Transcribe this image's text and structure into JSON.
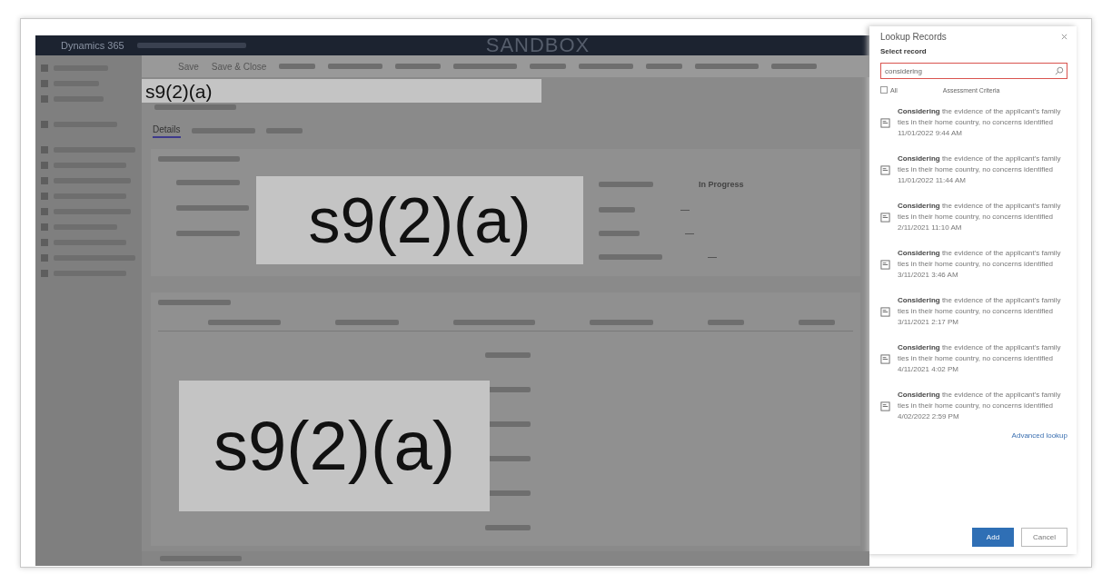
{
  "app": {
    "brand": "Dynamics 365",
    "environment": "SANDBOX"
  },
  "toolbar": [
    {
      "label": "Save"
    },
    {
      "label": "Save & Close"
    }
  ],
  "tabs": [
    {
      "label": "Details",
      "selected": true
    }
  ],
  "status": {
    "value": "In Progress"
  },
  "redactions": [
    "s9(2)(a)",
    "s9(2)(a)",
    "s9(2)(a)"
  ],
  "lookup": {
    "title": "Lookup Records",
    "subtitle": "Select record",
    "search": "considering",
    "all": {
      "label": "All",
      "checked": false
    },
    "column": "Assessment Criteria",
    "records": [
      {
        "text": "**Considering** the evidence of the applicant's family ties in their home country, no concerns identified",
        "date": "11/01/2022 9:44 AM"
      },
      {
        "text": "**Considering** the evidence of the applicant's family ties in their home country, no concerns identified",
        "date": "11/01/2022 11:44 AM"
      },
      {
        "text": "**Considering** the evidence of the applicant's family ties in their home country, no concerns identified",
        "date": "2/11/2021 11:10 AM"
      },
      {
        "text": "**Considering** the evidence of the applicant's family ties in their home country, no concerns identified",
        "date": "3/11/2021 3:46 AM"
      },
      {
        "text": "**Considering** the evidence of the applicant's family ties in their home country, no concerns identified",
        "date": "3/11/2021 2:17 PM"
      },
      {
        "text": "**Considering** the evidence of the applicant's family ties in their home country, no concerns identified",
        "date": "4/11/2021 4:02 PM"
      },
      {
        "text": "**Considering** the evidence of the applicant's family ties in their home country, no concerns identified",
        "date": "4/02/2022 2:59 PM"
      }
    ],
    "advanced": "Advanced lookup",
    "add": "Add",
    "cancel": "Cancel"
  }
}
